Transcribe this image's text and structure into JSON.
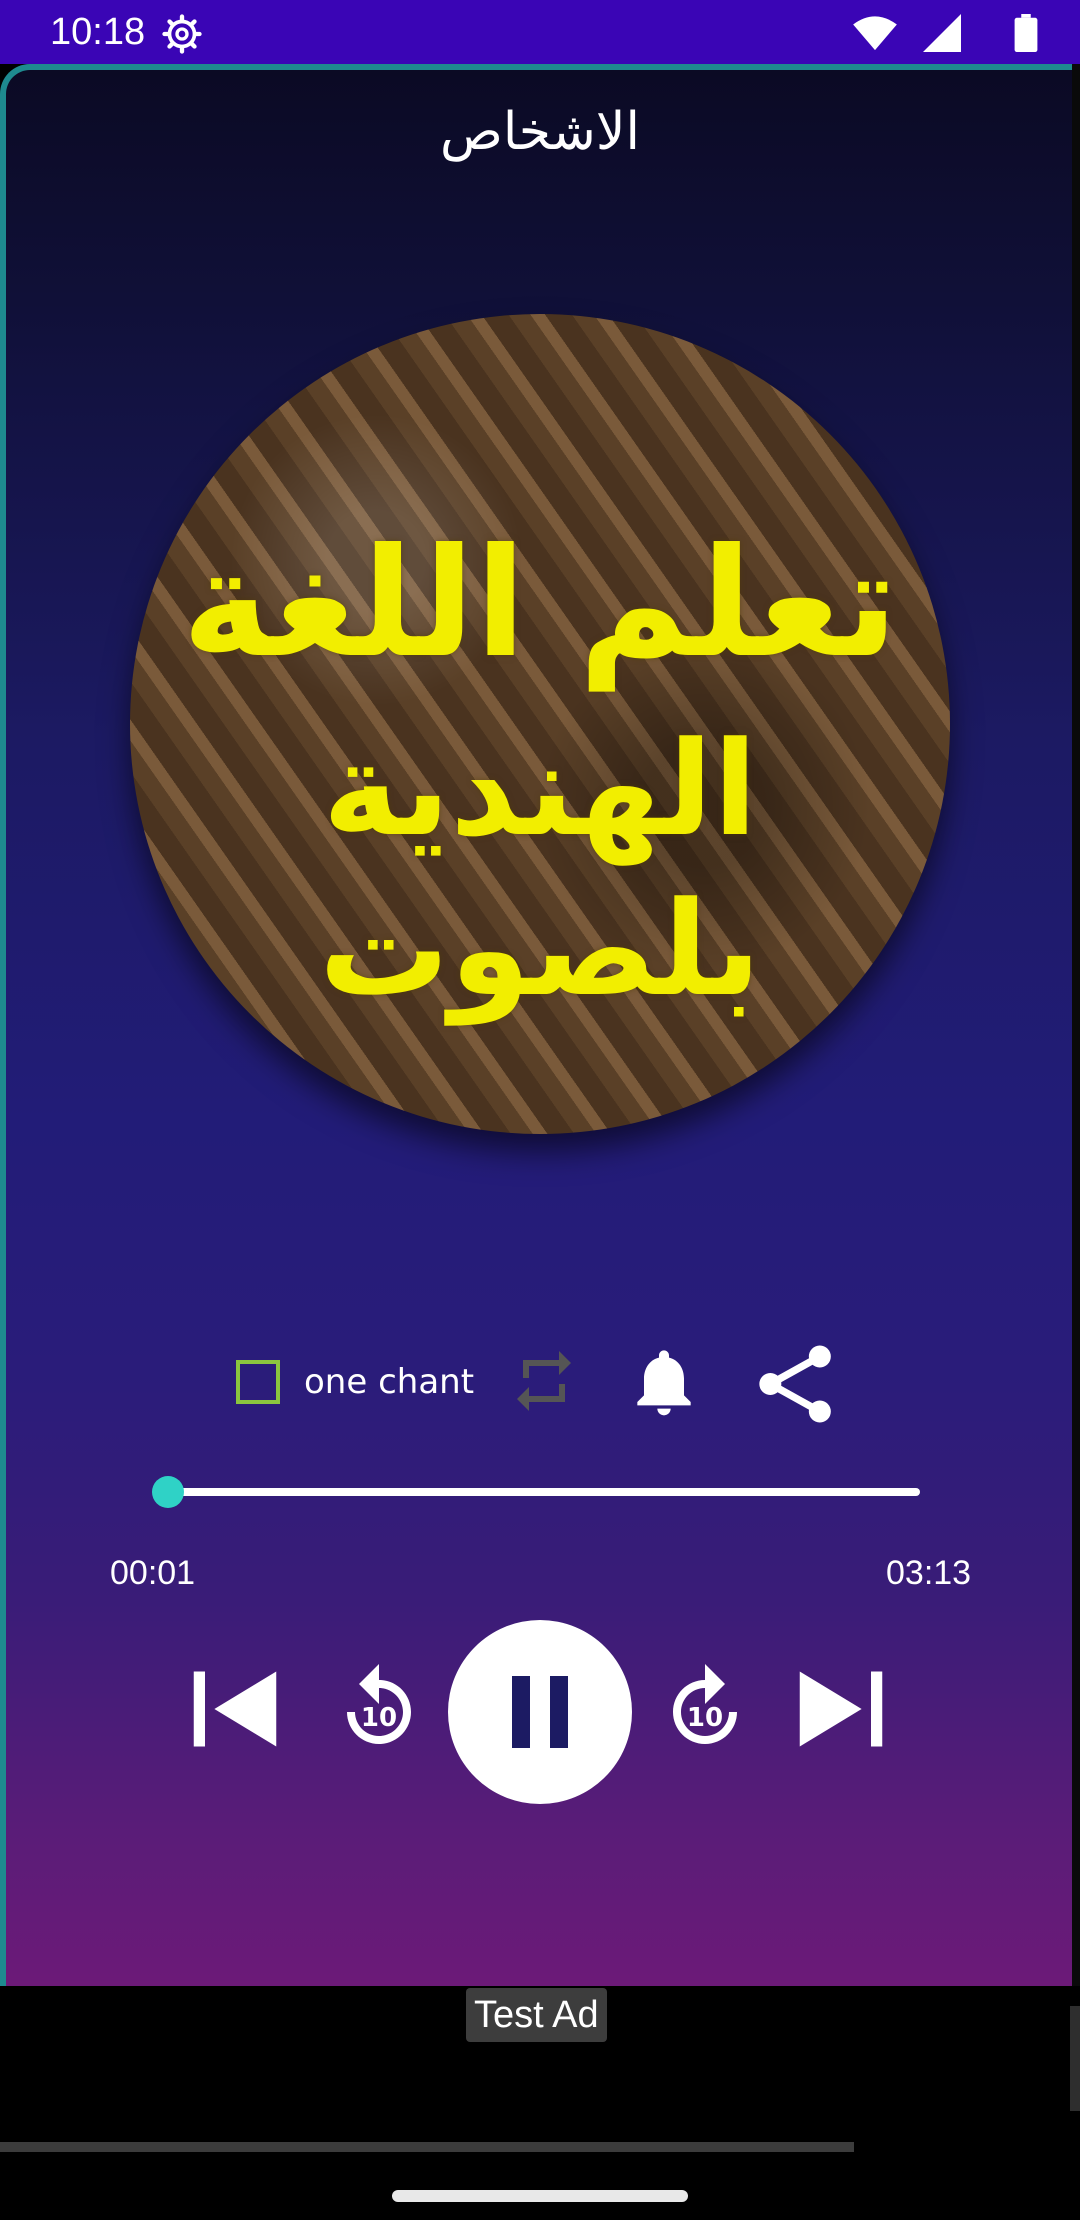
{
  "status_bar": {
    "time": "10:18",
    "icons": [
      "settings-gear-icon",
      "wifi-icon",
      "cell-signal-icon",
      "battery-icon"
    ],
    "background": "#3a05b5"
  },
  "player": {
    "title": "الاشخاص",
    "cover_art": {
      "line1": "تعلم اللغة",
      "line2": "الهندية بلصوت",
      "text_color": "#f2ee00"
    },
    "options": {
      "one_chant_label": "one chant",
      "one_chant_checked": false,
      "icons": [
        "repeat-icon",
        "bell-icon",
        "share-icon"
      ]
    },
    "progress": {
      "elapsed": "00:01",
      "total": "03:13",
      "fraction": 0.005
    },
    "controls": [
      "skip-previous-icon",
      "replay-10-icon",
      "pause-icon",
      "forward-10-icon",
      "skip-next-icon"
    ],
    "replay_seconds": "10",
    "forward_seconds": "10",
    "accent": "#2fd2c6"
  },
  "ad": {
    "label": "Test Ad"
  }
}
